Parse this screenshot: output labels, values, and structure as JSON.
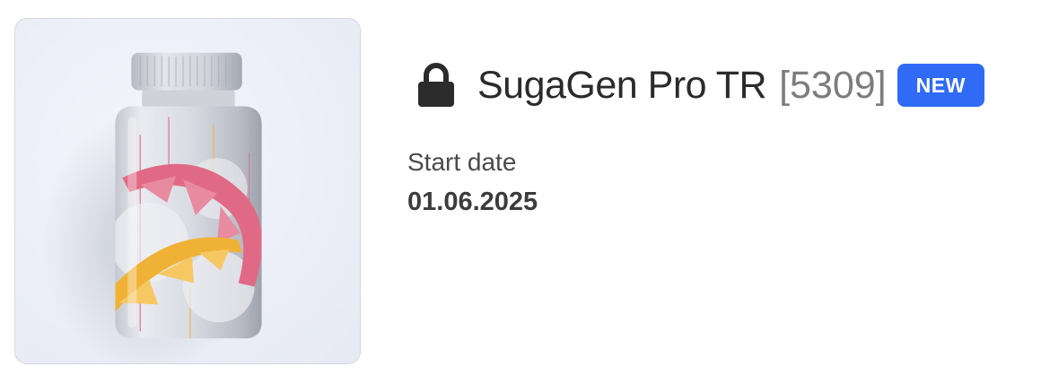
{
  "product": {
    "name": "SugaGen Pro TR",
    "id": "[5309]",
    "badge": "NEW",
    "locked": true,
    "image": "supplement-bottle"
  },
  "details": {
    "start_date_label": "Start date",
    "start_date_value": "01.06.2025"
  },
  "colors": {
    "badge_bg": "#2f6bf5",
    "title": "#2b2b2b",
    "id": "#7d7d7d"
  }
}
